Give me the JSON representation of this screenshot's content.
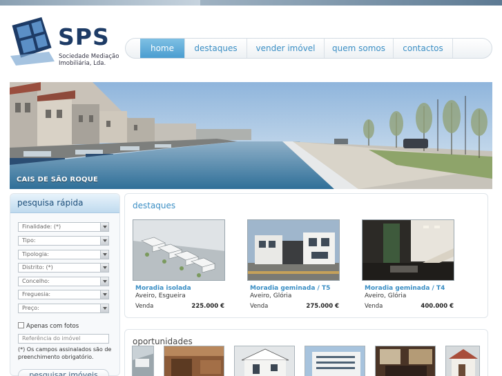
{
  "logo": {
    "name": "SPS",
    "subtitle_line1": "Sociedade Mediação",
    "subtitle_line2": "Imobiliária, Lda."
  },
  "nav": {
    "items": [
      {
        "label": "home",
        "active": true
      },
      {
        "label": "destaques",
        "active": false
      },
      {
        "label": "vender imóvel",
        "active": false
      },
      {
        "label": "quem somos",
        "active": false
      },
      {
        "label": "contactos",
        "active": false
      }
    ]
  },
  "banner": {
    "caption": "CAIS DE SÃO ROQUE"
  },
  "quick_search": {
    "title": "pesquisa rápida",
    "selects": [
      {
        "value": "Finalidade: (*)"
      },
      {
        "value": "Tipo:"
      },
      {
        "value": "Tipologia:"
      },
      {
        "value": "Distrito: (*)"
      },
      {
        "value": "Concelho:"
      },
      {
        "value": "Freguesia:"
      },
      {
        "value": "Preço:"
      }
    ],
    "checkbox_label": "Apenas com fotos",
    "reference_placeholder": "Referência do imóvel",
    "note": "(*) Os campos assinalados são de preenchimento obrigatório.",
    "submit_label": "pesquisar imóveis"
  },
  "highlights": {
    "title": "destaques",
    "items": [
      {
        "title": "Moradia isolada",
        "location": "Aveiro, Esgueira",
        "purpose": "Venda",
        "price": "225.000 €"
      },
      {
        "title": "Moradia geminada / T5",
        "location": "Aveiro, Glória",
        "purpose": "Venda",
        "price": "275.000 €"
      },
      {
        "title": "Moradia geminada / T4",
        "location": "Aveiro, Glória",
        "purpose": "Venda",
        "price": "400.000 €"
      }
    ]
  },
  "opportunities": {
    "title": "oportunidades",
    "thumb_count": 6
  },
  "colors": {
    "accent": "#3a8ec4",
    "brand": "#1d3b66",
    "nav_active": "#4a9dd0"
  }
}
